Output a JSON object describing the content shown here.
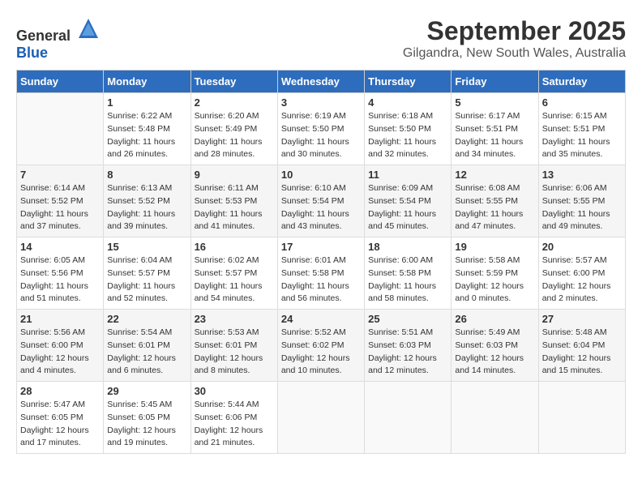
{
  "header": {
    "logo_general": "General",
    "logo_blue": "Blue",
    "title": "September 2025",
    "subtitle": "Gilgandra, New South Wales, Australia"
  },
  "calendar": {
    "days_of_week": [
      "Sunday",
      "Monday",
      "Tuesday",
      "Wednesday",
      "Thursday",
      "Friday",
      "Saturday"
    ],
    "weeks": [
      [
        {
          "day": "",
          "sunrise": "",
          "sunset": "",
          "daylight": ""
        },
        {
          "day": "1",
          "sunrise": "6:22 AM",
          "sunset": "5:48 PM",
          "daylight": "11 hours and 26 minutes."
        },
        {
          "day": "2",
          "sunrise": "6:20 AM",
          "sunset": "5:49 PM",
          "daylight": "11 hours and 28 minutes."
        },
        {
          "day": "3",
          "sunrise": "6:19 AM",
          "sunset": "5:50 PM",
          "daylight": "11 hours and 30 minutes."
        },
        {
          "day": "4",
          "sunrise": "6:18 AM",
          "sunset": "5:50 PM",
          "daylight": "11 hours and 32 minutes."
        },
        {
          "day": "5",
          "sunrise": "6:17 AM",
          "sunset": "5:51 PM",
          "daylight": "11 hours and 34 minutes."
        },
        {
          "day": "6",
          "sunrise": "6:15 AM",
          "sunset": "5:51 PM",
          "daylight": "11 hours and 35 minutes."
        }
      ],
      [
        {
          "day": "7",
          "sunrise": "6:14 AM",
          "sunset": "5:52 PM",
          "daylight": "11 hours and 37 minutes."
        },
        {
          "day": "8",
          "sunrise": "6:13 AM",
          "sunset": "5:52 PM",
          "daylight": "11 hours and 39 minutes."
        },
        {
          "day": "9",
          "sunrise": "6:11 AM",
          "sunset": "5:53 PM",
          "daylight": "11 hours and 41 minutes."
        },
        {
          "day": "10",
          "sunrise": "6:10 AM",
          "sunset": "5:54 PM",
          "daylight": "11 hours and 43 minutes."
        },
        {
          "day": "11",
          "sunrise": "6:09 AM",
          "sunset": "5:54 PM",
          "daylight": "11 hours and 45 minutes."
        },
        {
          "day": "12",
          "sunrise": "6:08 AM",
          "sunset": "5:55 PM",
          "daylight": "11 hours and 47 minutes."
        },
        {
          "day": "13",
          "sunrise": "6:06 AM",
          "sunset": "5:55 PM",
          "daylight": "11 hours and 49 minutes."
        }
      ],
      [
        {
          "day": "14",
          "sunrise": "6:05 AM",
          "sunset": "5:56 PM",
          "daylight": "11 hours and 51 minutes."
        },
        {
          "day": "15",
          "sunrise": "6:04 AM",
          "sunset": "5:57 PM",
          "daylight": "11 hours and 52 minutes."
        },
        {
          "day": "16",
          "sunrise": "6:02 AM",
          "sunset": "5:57 PM",
          "daylight": "11 hours and 54 minutes."
        },
        {
          "day": "17",
          "sunrise": "6:01 AM",
          "sunset": "5:58 PM",
          "daylight": "11 hours and 56 minutes."
        },
        {
          "day": "18",
          "sunrise": "6:00 AM",
          "sunset": "5:58 PM",
          "daylight": "11 hours and 58 minutes."
        },
        {
          "day": "19",
          "sunrise": "5:58 AM",
          "sunset": "5:59 PM",
          "daylight": "12 hours and 0 minutes."
        },
        {
          "day": "20",
          "sunrise": "5:57 AM",
          "sunset": "6:00 PM",
          "daylight": "12 hours and 2 minutes."
        }
      ],
      [
        {
          "day": "21",
          "sunrise": "5:56 AM",
          "sunset": "6:00 PM",
          "daylight": "12 hours and 4 minutes."
        },
        {
          "day": "22",
          "sunrise": "5:54 AM",
          "sunset": "6:01 PM",
          "daylight": "12 hours and 6 minutes."
        },
        {
          "day": "23",
          "sunrise": "5:53 AM",
          "sunset": "6:01 PM",
          "daylight": "12 hours and 8 minutes."
        },
        {
          "day": "24",
          "sunrise": "5:52 AM",
          "sunset": "6:02 PM",
          "daylight": "12 hours and 10 minutes."
        },
        {
          "day": "25",
          "sunrise": "5:51 AM",
          "sunset": "6:03 PM",
          "daylight": "12 hours and 12 minutes."
        },
        {
          "day": "26",
          "sunrise": "5:49 AM",
          "sunset": "6:03 PM",
          "daylight": "12 hours and 14 minutes."
        },
        {
          "day": "27",
          "sunrise": "5:48 AM",
          "sunset": "6:04 PM",
          "daylight": "12 hours and 15 minutes."
        }
      ],
      [
        {
          "day": "28",
          "sunrise": "5:47 AM",
          "sunset": "6:05 PM",
          "daylight": "12 hours and 17 minutes."
        },
        {
          "day": "29",
          "sunrise": "5:45 AM",
          "sunset": "6:05 PM",
          "daylight": "12 hours and 19 minutes."
        },
        {
          "day": "30",
          "sunrise": "5:44 AM",
          "sunset": "6:06 PM",
          "daylight": "12 hours and 21 minutes."
        },
        {
          "day": "",
          "sunrise": "",
          "sunset": "",
          "daylight": ""
        },
        {
          "day": "",
          "sunrise": "",
          "sunset": "",
          "daylight": ""
        },
        {
          "day": "",
          "sunrise": "",
          "sunset": "",
          "daylight": ""
        },
        {
          "day": "",
          "sunrise": "",
          "sunset": "",
          "daylight": ""
        }
      ]
    ]
  }
}
